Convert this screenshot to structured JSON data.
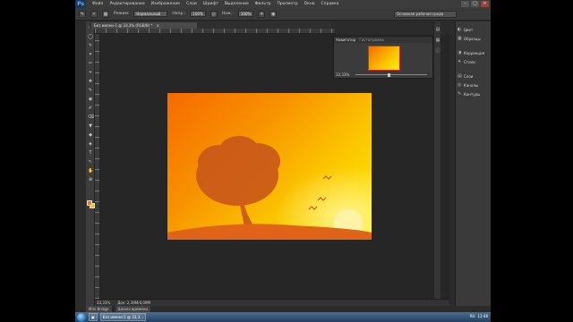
{
  "app": {
    "logo": "Ps"
  },
  "menu": [
    "Файл",
    "Редактирование",
    "Изображение",
    "Слои",
    "Шрифт",
    "Выделение",
    "Фильтр",
    "Просмотр",
    "Окно",
    "Справка"
  ],
  "window_controls": {
    "minimize": "–",
    "maximize": "□",
    "close": "×"
  },
  "options_bar": {
    "mode_label": "Режим:",
    "mode_value": "Нормальный",
    "opacity_label": "Непр.:",
    "opacity_value": "100%",
    "flow_label": "Наж.:",
    "flow_value": "100%",
    "workspace": "Основная рабочая среда"
  },
  "document_tab": {
    "title": "Без имени-1 @ 33,3% (RGB/8) *",
    "close": "×"
  },
  "tools": [
    "▭",
    "◯",
    "✎",
    "⌗",
    "✂",
    "⌖",
    "✚",
    "✎",
    "◉",
    "✐",
    "⌫",
    "▼",
    "◆",
    "◈",
    "T",
    "↖",
    "✋",
    "⊕"
  ],
  "colors": {
    "foreground": "#e8801c",
    "background": "#f5c400",
    "tree": "#c9571a",
    "hill": "#e0631a"
  },
  "navigator": {
    "tab_active": "Навигатор",
    "tab_inactive": "Гистограмма",
    "zoom": "33,33%"
  },
  "panels": [
    {
      "icon": "◐",
      "label": "Цвет"
    },
    {
      "icon": "▦",
      "label": "Образцы"
    },
    {
      "icon": "◑",
      "label": "Коррекция"
    },
    {
      "icon": "✦",
      "label": "Стили"
    },
    {
      "icon": "▤",
      "label": "Слои"
    },
    {
      "icon": "◎",
      "label": "Каналы"
    },
    {
      "icon": "✎",
      "label": "Контуры"
    }
  ],
  "status": {
    "zoom": "33,33%",
    "doc": "Док: 2,39M/4,09M"
  },
  "mini_tabs": [
    "Mini Bridge",
    "Шкала времени"
  ],
  "taskbar": {
    "items": [
      "Без имени-1 @ 33,3..."
    ],
    "lang": "RU",
    "time": "12:48"
  }
}
